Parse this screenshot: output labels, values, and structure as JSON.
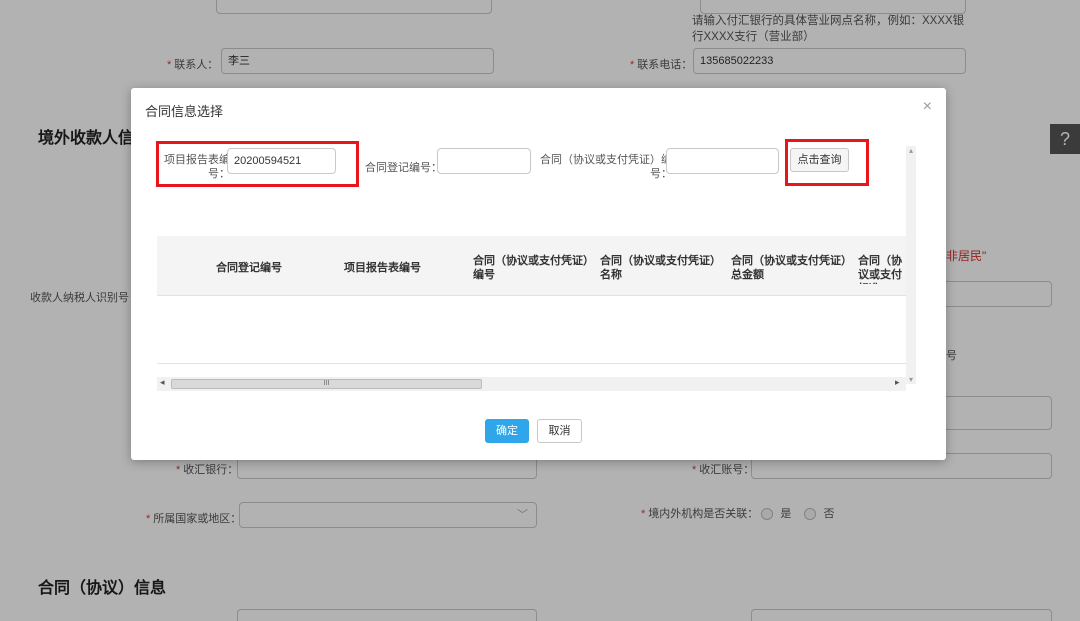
{
  "background_form": {
    "bank_hint": "请输入付汇银行的具体营业网点名称，例如：XXXX银行XXXX支行（营业部）",
    "contact_label": "联系人：",
    "contact_value": "李三",
    "phone_label": "联系电话：",
    "phone_value": "135685022233",
    "section_overseas": "境外收款人信",
    "taxid_label": "收款人纳税人识别号（",
    "nonresident_note": "非居民\"",
    "partial_char": "号",
    "bank_label": "收汇银行：",
    "account_label": "收汇账号：",
    "country_label": "所属国家或地区：",
    "related_label": "境内外机构是否关联：",
    "yes_label": "是",
    "no_label": "否",
    "section_contract": "合同（协议）信息",
    "help_icon": "question-circle-icon"
  },
  "modal": {
    "title": "合同信息选择",
    "close": "×",
    "search": {
      "project_label_line1": "项目报告表编",
      "project_label_line2": "号：",
      "project_value": "20200594521",
      "contract_reg_label": "合同登记编号：",
      "contract_reg_value": "",
      "contract_no_label_line1": "合同（协议或支付凭证）编",
      "contract_no_label_line2": "号：",
      "contract_no_value": "",
      "query_button": "点击查询"
    },
    "table": {
      "headers": [
        "合同登记编号",
        "项目报告表编号",
        "合同（协议或支付凭证）编号",
        "合同（协议或支付凭证）名称",
        "合同（协议或支付凭证）总金额",
        "合同（协议或支付标准"
      ],
      "rows": []
    },
    "scroll": {
      "left_arrow": "◂",
      "right_arrow": "▸",
      "up_arrow": "▴",
      "down_arrow": "▾",
      "grip": "III"
    },
    "ok_button": "确定",
    "cancel_button": "取消"
  },
  "colors": {
    "highlight_red": "#e8151b",
    "primary_blue": "#2fa5ea",
    "required_red": "#e03a3a"
  }
}
